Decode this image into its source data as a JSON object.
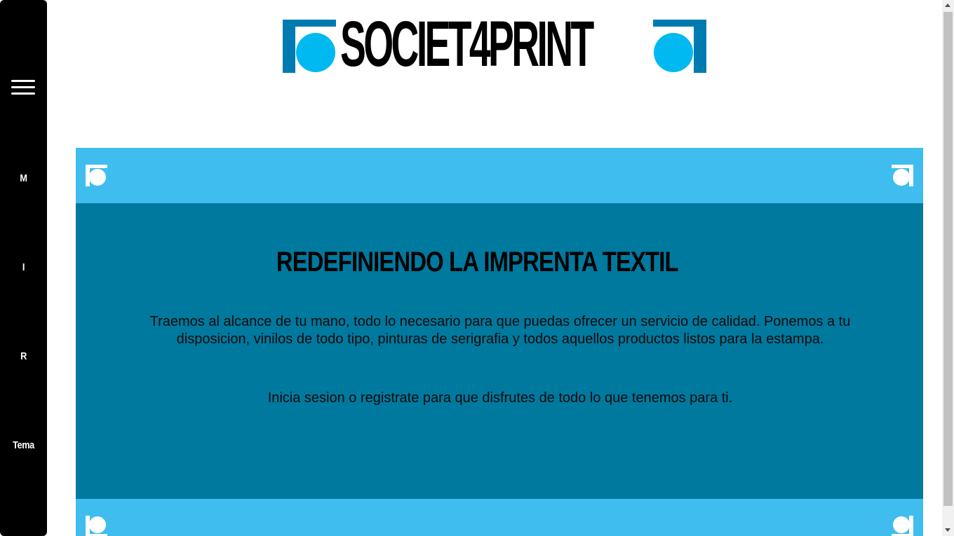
{
  "sidebar": {
    "menu_icon": "hamburger-menu-icon",
    "items": [
      {
        "label": "M"
      },
      {
        "label": "I"
      },
      {
        "label": "R"
      },
      {
        "label": "Tema"
      }
    ]
  },
  "brand": {
    "name": "SOCIET4PRINT",
    "icon": "circle-in-bracket-icon",
    "colors": {
      "bracket": "#007bb2",
      "circle": "#00b9f1",
      "text": "#000000"
    }
  },
  "hero": {
    "title": "REDEFINIENDO LA IMPRENTA TEXTIL",
    "description": "Traemos al alcance de tu mano, todo lo necesario para que puedas ofrecer un servicio de calidad. Ponemos a tu disposicion, vinilos de todo tipo, pinturas de serigrafia y todos aquellos productos listos para la estampa.",
    "cta": "Inicia sesion o registrate para que disfrutes de todo lo que tenemos para ti."
  },
  "colors": {
    "sidebar": "#000000",
    "band": "#40bdef",
    "panel": "#00799f"
  }
}
